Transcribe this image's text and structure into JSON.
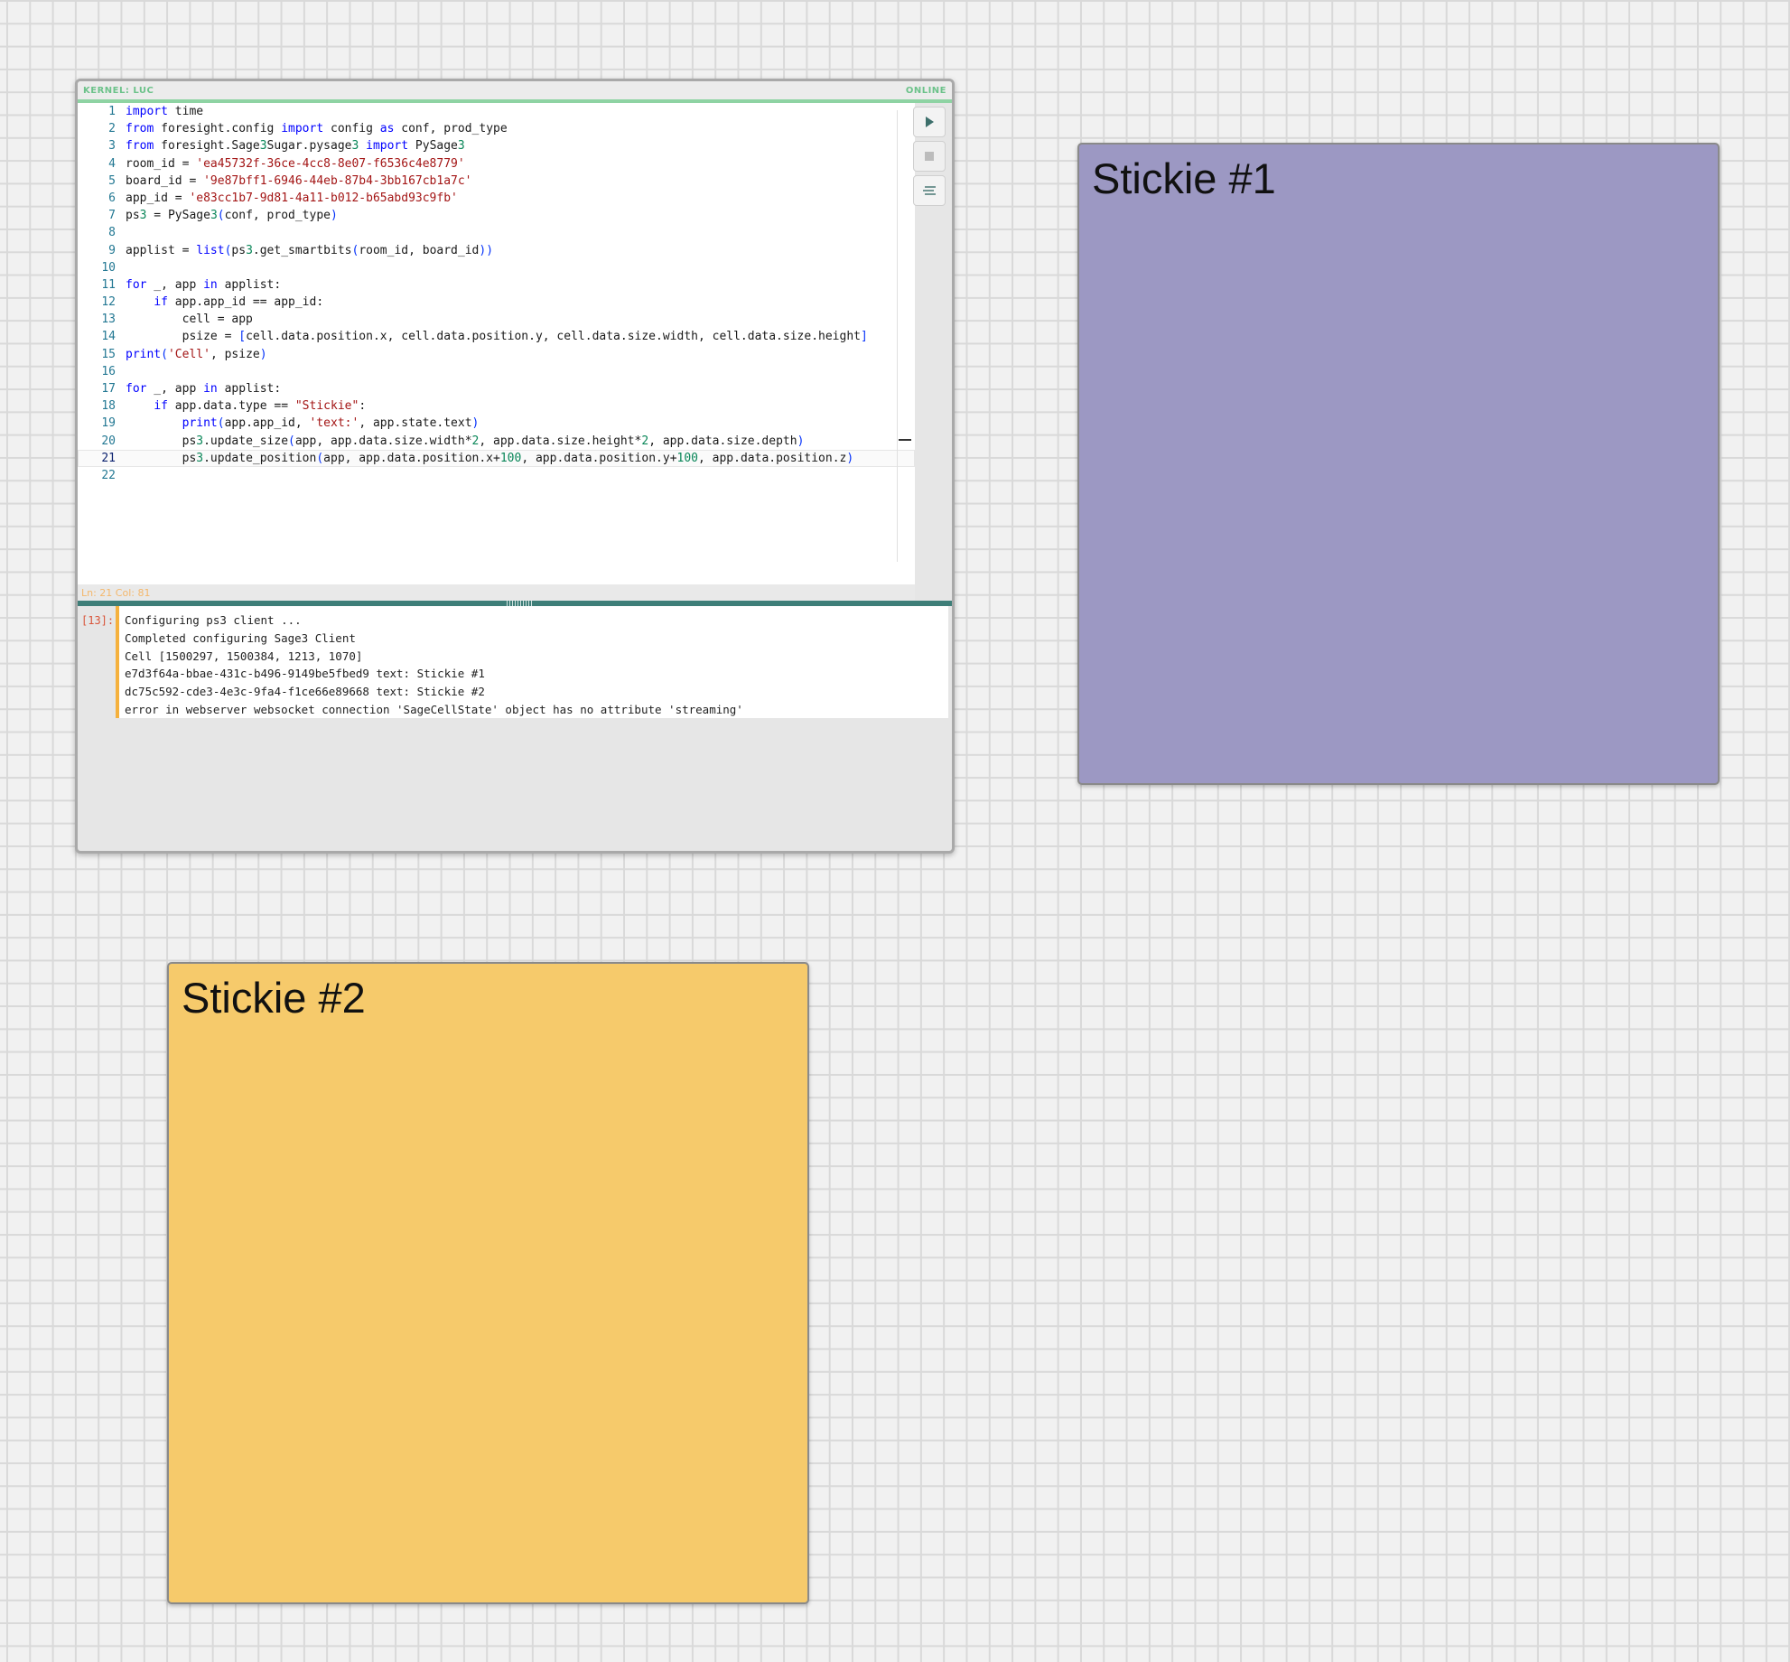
{
  "cell": {
    "kernel_label": "KERNEL: LUC",
    "status_label": "ONLINE",
    "cursor_status": "Ln: 21 Col: 81",
    "execution_count": "[13]:",
    "code_lines": [
      {
        "n": "1",
        "text": "import time"
      },
      {
        "n": "2",
        "text": "from foresight.config import config as conf, prod_type"
      },
      {
        "n": "3",
        "text": "from foresight.Sage3Sugar.pysage3 import PySage3"
      },
      {
        "n": "4",
        "text": "room_id = 'ea45732f-36ce-4cc8-8e07-f6536c4e8779'"
      },
      {
        "n": "5",
        "text": "board_id = '9e87bff1-6946-44eb-87b4-3bb167cb1a7c'"
      },
      {
        "n": "6",
        "text": "app_id = 'e83cc1b7-9d81-4a11-b012-b65abd93c9fb'"
      },
      {
        "n": "7",
        "text": "ps3 = PySage3(conf, prod_type)"
      },
      {
        "n": "8",
        "text": ""
      },
      {
        "n": "9",
        "text": "applist = list(ps3.get_smartbits(room_id, board_id))"
      },
      {
        "n": "10",
        "text": ""
      },
      {
        "n": "11",
        "text": "for _, app in applist:"
      },
      {
        "n": "12",
        "text": "    if app.app_id == app_id:"
      },
      {
        "n": "13",
        "text": "        cell = app"
      },
      {
        "n": "14",
        "text": "        psize = [cell.data.position.x, cell.data.position.y, cell.data.size.width, cell.data.size.height]"
      },
      {
        "n": "15",
        "text": "print('Cell', psize)"
      },
      {
        "n": "16",
        "text": ""
      },
      {
        "n": "17",
        "text": "for _, app in applist:"
      },
      {
        "n": "18",
        "text": "    if app.data.type == \"Stickie\":"
      },
      {
        "n": "19",
        "text": "        print(app.app_id, 'text:', app.state.text)"
      },
      {
        "n": "20",
        "text": "        ps3.update_size(app, app.data.size.width*2, app.data.size.height*2, app.data.size.depth)"
      },
      {
        "n": "21",
        "text": "        ps3.update_position(app, app.data.position.x+100, app.data.position.y+100, app.data.position.z)"
      },
      {
        "n": "22",
        "text": ""
      }
    ],
    "output_lines": [
      "Configuring ps3 client ...",
      "Completed configuring Sage3 Client",
      "Cell [1500297, 1500384, 1213, 1070]",
      "e7d3f64a-bbae-431c-b496-9149be5fbed9 text: Stickie #1",
      "dc75c592-cde3-4e3c-9fa4-f1ce66e89668 text: Stickie #2",
      "error in webserver websocket connection 'SageCellState' object has no attribute 'streaming'"
    ],
    "toolbar": {
      "run_icon": "play-icon",
      "stop_icon": "stop-icon",
      "clear_icon": "clear-output-icon"
    }
  },
  "stickies": [
    {
      "text": "Stickie #1",
      "color": "#9c98c3"
    },
    {
      "text": "Stickie #2",
      "color": "#f6ca6b"
    }
  ],
  "colors": {
    "online": "#6cc28a",
    "divider": "#3e7e78",
    "output_accent": "#f5b13d",
    "error_count": "#d9553a"
  }
}
